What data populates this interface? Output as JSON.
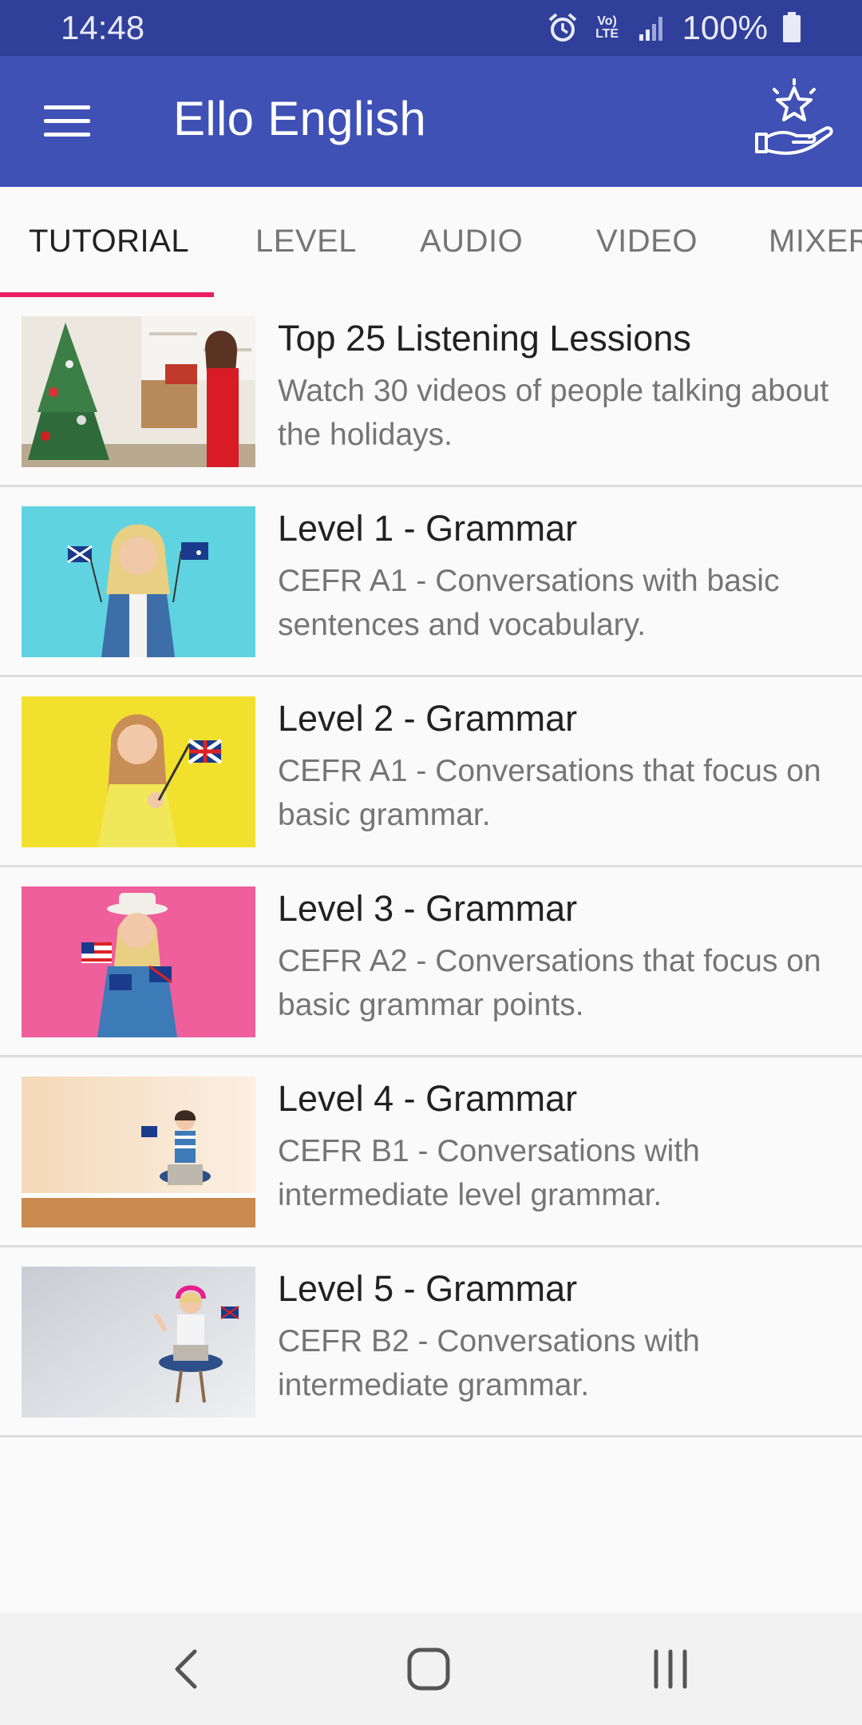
{
  "status_bar": {
    "time": "14:48",
    "network_label": "Vo) LTE",
    "battery": "100%"
  },
  "app_bar": {
    "title": "Ello English",
    "menu_icon": "hamburger-menu-icon",
    "action_icon": "gift-star-hand-icon"
  },
  "tabs": [
    {
      "label": "TUTORIAL",
      "active": true
    },
    {
      "label": "LEVEL",
      "active": false
    },
    {
      "label": "AUDIO",
      "active": false
    },
    {
      "label": "VIDEO",
      "active": false
    },
    {
      "label": "MIXER",
      "active": false
    }
  ],
  "lessons": [
    {
      "title": "Top 25 Listening Lessions",
      "description": "Watch 30 videos of people talking about the holidays."
    },
    {
      "title": "Level 1 - Grammar",
      "description": "CEFR A1 - Conversations with basic sentences and vocabulary."
    },
    {
      "title": "Level 2 - Grammar",
      "description": "CEFR A1 - Conversations that focus on basic grammar."
    },
    {
      "title": "Level 3 - Grammar",
      "description": "CEFR A2 - Conversations that focus on basic grammar points."
    },
    {
      "title": "Level 4 - Grammar",
      "description": "CEFR B1 - Conversations with intermediate level grammar."
    },
    {
      "title": "Level 5 - Grammar",
      "description": "CEFR B2 - Conversations with intermediate grammar."
    }
  ],
  "colors": {
    "status_bar": "#2f3f9a",
    "app_bar": "#3f51b5",
    "tab_indicator": "#e91e63",
    "background": "#fafafa"
  },
  "nav_bar": {
    "back_icon": "back-chevron-icon",
    "home_icon": "home-square-icon",
    "recents_icon": "recents-bars-icon"
  }
}
